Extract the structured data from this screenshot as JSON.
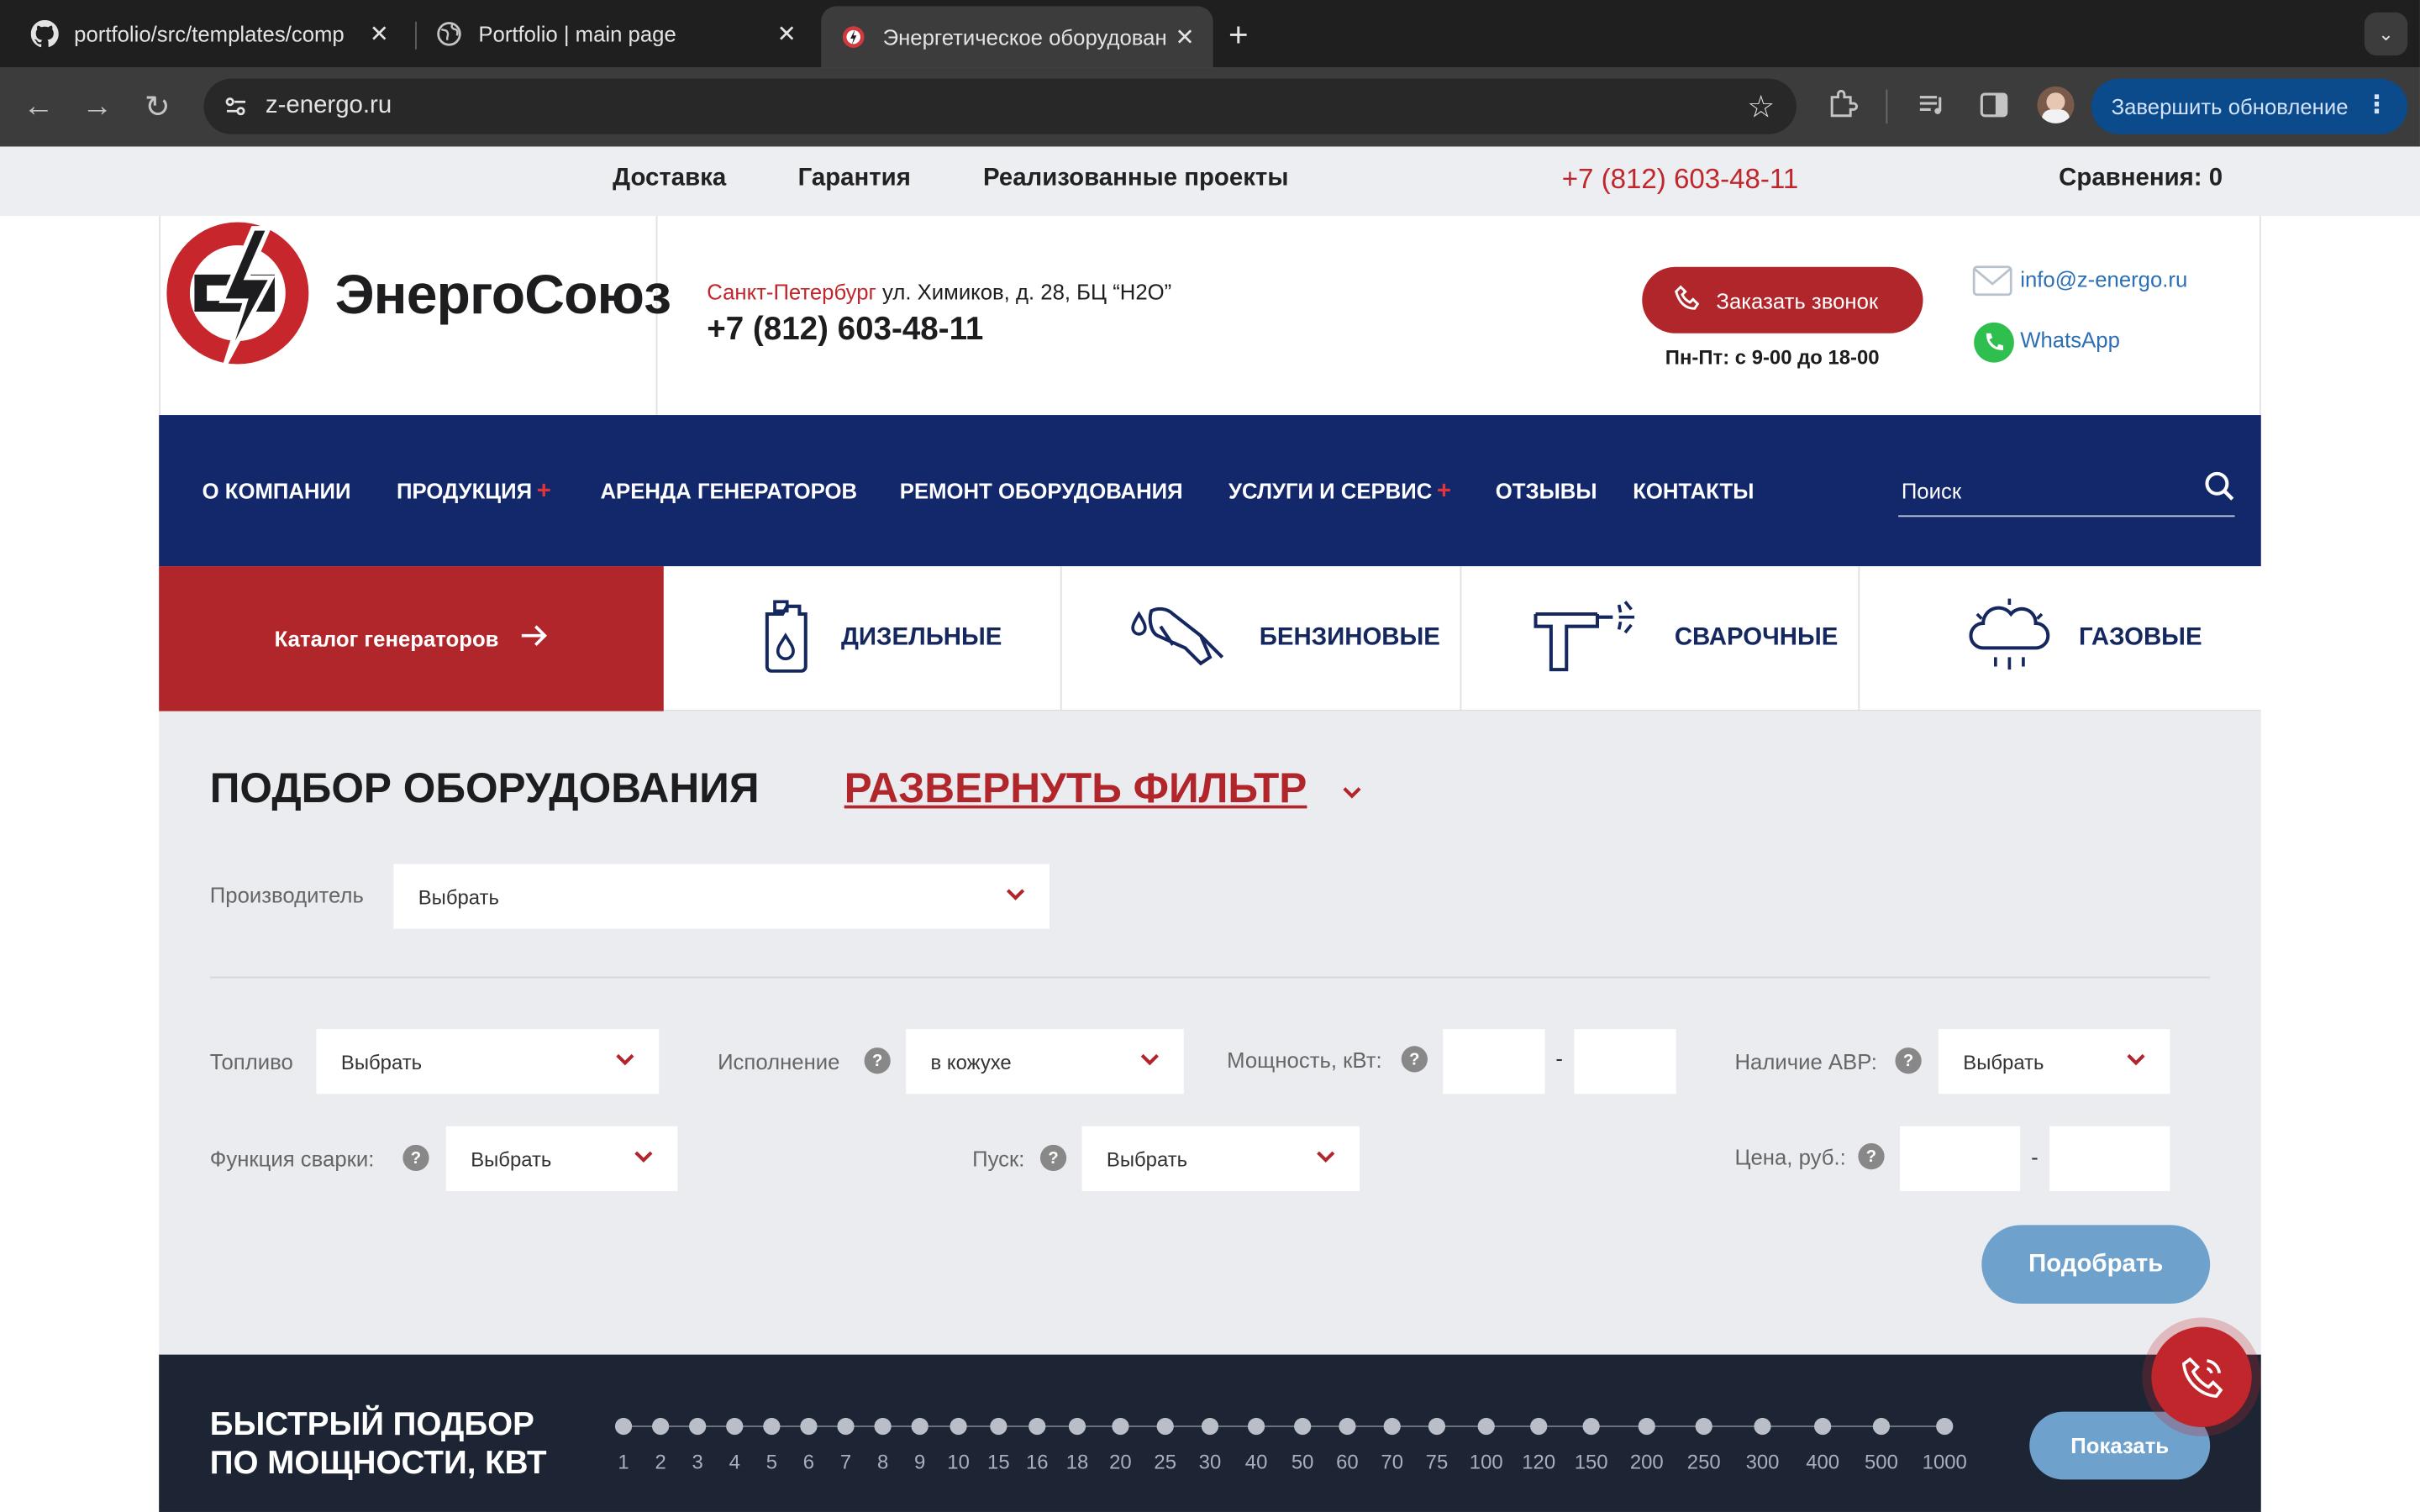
{
  "browser": {
    "tabs": [
      {
        "title": "portfolio/src/templates/comp",
        "icon": "github-icon"
      },
      {
        "title": "Portfolio | main page",
        "icon": "globe-icon"
      },
      {
        "title": "Энергетическое оборудован",
        "icon": "energosoyuz-favicon",
        "active": true
      }
    ],
    "new_tab": "+",
    "url": "z-energo.ru",
    "update_button": "Завершить обновление"
  },
  "topbar": {
    "links": [
      "Доставка",
      "Гарантия",
      "Реализованные проекты"
    ],
    "phone": "+7 (812) 603-48-11",
    "compare": "Сравнения: 0"
  },
  "header": {
    "logo_text": "ЭнергоСоюз",
    "city": "Санкт-Петербург",
    "address": "ул. Химиков, д. 28, БЦ “H2O”",
    "phone": "+7 (812) 603-48-11",
    "callback_button": "Заказать звонок",
    "hours": "Пн-Пт: с 9-00 до 18-00",
    "email": "info@z-energo.ru",
    "whatsapp": "WhatsApp"
  },
  "nav": {
    "items": [
      {
        "label": "О КОМПАНИИ",
        "plus": ""
      },
      {
        "label": "ПРОДУКЦИЯ",
        "plus": "+"
      },
      {
        "label": "АРЕНДА ГЕНЕРАТОРОВ",
        "plus": ""
      },
      {
        "label": "РЕМОНТ ОБОРУДОВАНИЯ",
        "plus": ""
      },
      {
        "label": "УСЛУГИ И СЕРВИС",
        "plus": "+"
      },
      {
        "label": "ОТЗЫВЫ",
        "plus": ""
      },
      {
        "label": "КОНТАКТЫ",
        "plus": ""
      }
    ],
    "search_placeholder": "Поиск"
  },
  "categories": {
    "catalog": "Каталог генераторов",
    "items": [
      {
        "label": "ДИЗЕЛЬНЫЕ",
        "icon": "canister-icon"
      },
      {
        "label": "БЕНЗИНОВЫЕ",
        "icon": "fuel-nozzle-icon"
      },
      {
        "label": "СВАРОЧНЫЕ",
        "icon": "welding-torch-icon"
      },
      {
        "label": "ГАЗОВЫЕ",
        "icon": "gas-cloud-icon"
      }
    ]
  },
  "filter": {
    "title": "ПОДБОР ОБОРУДОВАНИЯ",
    "expand": "РАЗВЕРНУТЬ ФИЛЬТР",
    "manufacturer_label": "Производитель",
    "manufacturer_value": "Выбрать",
    "fuel_label": "Топливо",
    "fuel_value": "Выбрать",
    "execution_label": "Исполнение",
    "execution_value": "в кожухе",
    "power_label": "Мощность, кВт:",
    "dash": "-",
    "avr_label": "Наличие АВР:",
    "avr_value": "Выбрать",
    "welding_label": "Функция сварки:",
    "welding_value": "Выбрать",
    "start_label": "Пуск:",
    "start_value": "Выбрать",
    "price_label": "Цена, руб.:",
    "help": "?",
    "submit": "Подобрать"
  },
  "quick": {
    "title_line1": "БЫСТРЫЙ ПОДБОР",
    "title_line2": "ПО МОЩНОСТИ, КВТ",
    "values": [
      "1",
      "2",
      "3",
      "4",
      "5",
      "6",
      "7",
      "8",
      "9",
      "10",
      "15",
      "16",
      "18",
      "20",
      "25",
      "30",
      "40",
      "50",
      "60",
      "70",
      "75",
      "100",
      "120",
      "150",
      "200",
      "250",
      "300",
      "400",
      "500",
      "1000"
    ],
    "show_button": "Показать"
  },
  "colors": {
    "brand_red": "#b1262b",
    "navy": "#13286b",
    "dark": "#1d2433",
    "button_blue": "#6fa1cd"
  }
}
